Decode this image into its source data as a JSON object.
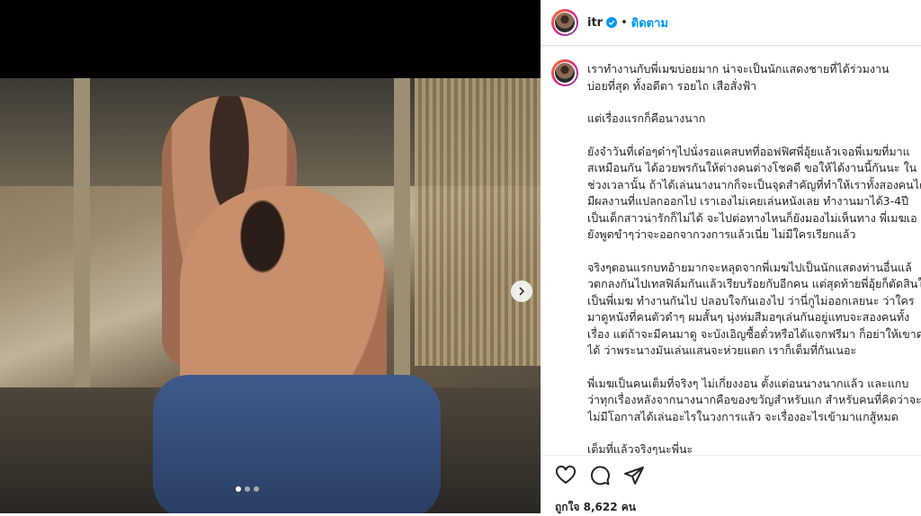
{
  "post": {
    "username": "itr",
    "separator": "•",
    "follow_label": "ติดตาม",
    "carousel": {
      "slide_count": 3,
      "active_index": 0
    },
    "caption": {
      "paragraphs": [
        [
          "เราทำงานกับพี่เมฆบ่อยมาก น่าจะเป็นนักแสดงชายที่ได้ร่วมงาน",
          "บ่อยที่สุด ทั้งอดีตา รอยไถ เสือสั่งฟ้า"
        ],
        [
          "แต่เรื่องแรกก็คือนางนาก"
        ],
        [
          "ยังจำวันที่เด๋อๆด๋าๆไปนั่งรอแคสบทที่ออฟฟิศพี่อุ้ยแล้วเจอพี่เมฆที่มาแ",
          "สเหมือนกัน ได้อวยพรกันให้ต่างคนต่างโชคดี ขอให้ได้งานนี้กันนะ ใน",
          "ช่วงเวลานั้น ถ้าได้เล่นนางนากก็จะเป็นจุดสำคัญที่ทำให้เราทั้งสองคนได้",
          "มีผลงานที่แปลกออกไป เราเองไม่เคยเล่นหนังเลย ทำงานมาได้3-4ปี",
          "เป็นเด็กสาวน่ารักก็ไม่ได้ จะไปต่อทางไหนก็ยังมองไม่เห็นทาง พี่เมฆเอ",
          "ยังพูดขำๆว่าจะออกจากวงการแล้วเนี่ย ไม่มีใครเรียกแล้ว"
        ],
        [
          "จริงๆตอนแรกบทอ้ายมากจะหลุดจากพี่เมฆไปเป็นนักแสดงท่านอื่นแล้",
          "วตกลงกันไปเทสฟิล์มกันแล้วเรียบร้อยกับอีกคน แต่สุดท้ายพี่อุ้ยก็ตัดสินใจ",
          "เป็นพี่เมฆ ทำงานกันไป ปลอบใจกันเองไป ว่านี่กูไม่ออกเลยนะ ว่าใคร",
          "มาดูหนังที่คนตัวดำๆ ผมสั้นๆ นุ่งห่มสีมอๆเล่นกันอยู่แทบจะสองคนทั้ง",
          "เรื่อง แต่ถ้าจะมีคนมาดู จะบังเอิญซื้อตั๋วหรือได้แจกฟรีมา ก็อย่าให้เขาด",
          "ได้ ว่าพระนางมันเล่นแสนจะห่วยแตก เราก็เต็มที่กันเนอะ"
        ],
        [
          "พี่เมฆเป็นคนเต็มที่จริงๆ ไม่เกี่ยงงอน ตั้งแต่อนนางนากแล้ว และแกบ",
          "ว่าทุกเรื่องหลังจากนางนากคือของขวัญสำหรับแก สำหรับคนที่คิดว่าจะ",
          "ไม่มีโอกาสได้เล่นอะไรในวงการแล้ว จะเรื่องอะไรเข้ามาแกสู้หมด"
        ],
        [
          "เต็มที่แล้วจริงๆนะพี่นะ"
        ]
      ]
    },
    "likes_text": "ถูกใจ 8,622 คน",
    "icons": [
      "heart-icon",
      "comment-icon",
      "share-icon",
      "verified-badge-icon",
      "chevron-right-icon"
    ],
    "colors": {
      "accent": "#0095f6",
      "text": "#262626",
      "border": "#dbdbdb"
    }
  }
}
